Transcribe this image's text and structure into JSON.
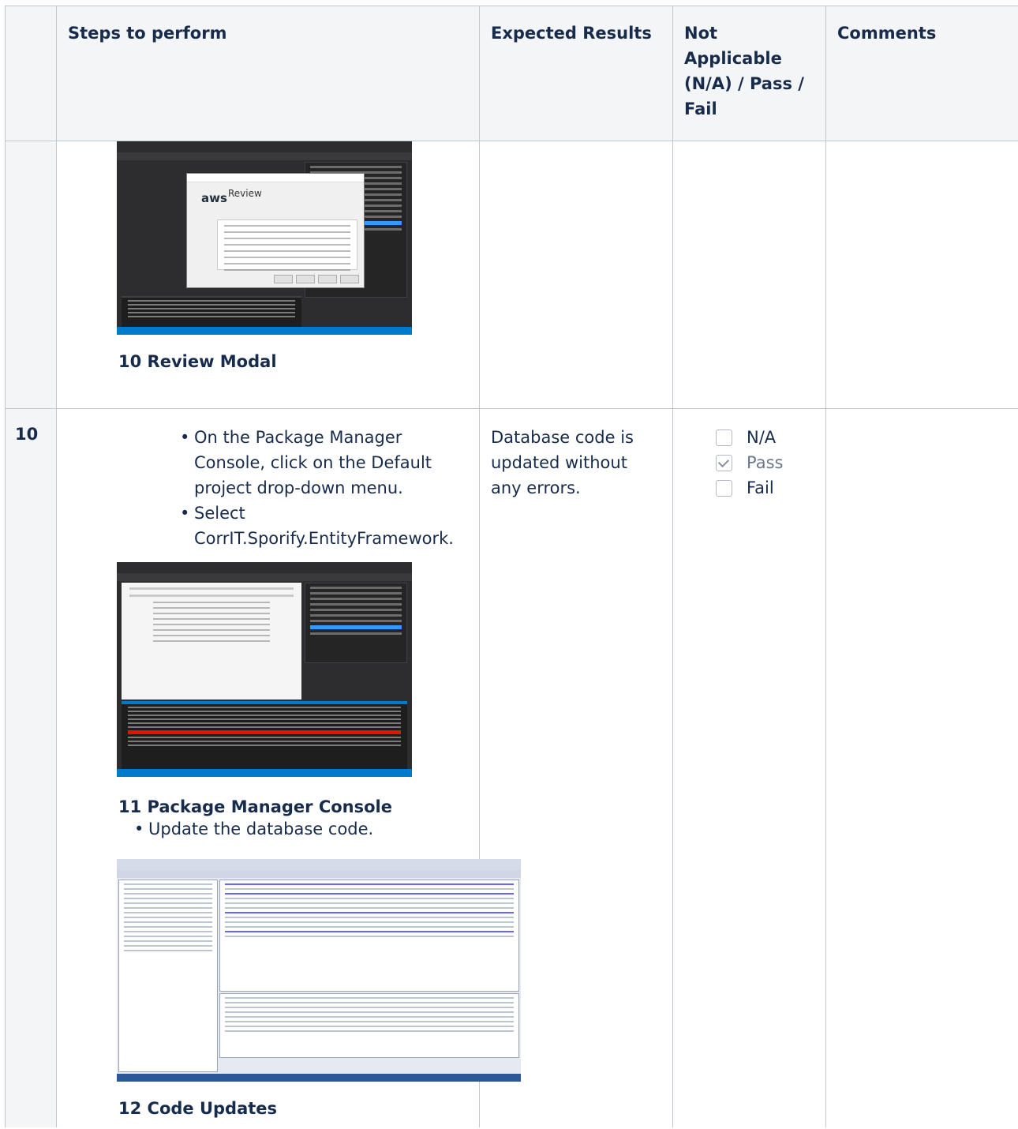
{
  "table": {
    "headers": {
      "steps": "Steps to perform",
      "expected": "Expected Results",
      "status": "Not Applicable (N/A) / Pass / Fail",
      "comments": "Comments"
    },
    "row_review": {
      "caption": "10 Review Modal",
      "screenshot": {
        "dialog_brand": "aws",
        "dialog_title": "Review"
      }
    },
    "row_10": {
      "number": "10",
      "bullets": [
        "On the Package Manager Console, click on the Default project drop-down menu.",
        "Select CorrIT.Sporify.EntityFramework."
      ],
      "caption_pmc": "11 Package Manager Console",
      "bullet_pmc": "Update the database code.",
      "caption_code": "12 Code Updates",
      "expected": "Database code is updated without any errors.",
      "options": [
        {
          "label": "N/A",
          "checked": false
        },
        {
          "label": "Pass",
          "checked": true
        },
        {
          "label": "Fail",
          "checked": false
        }
      ]
    }
  }
}
